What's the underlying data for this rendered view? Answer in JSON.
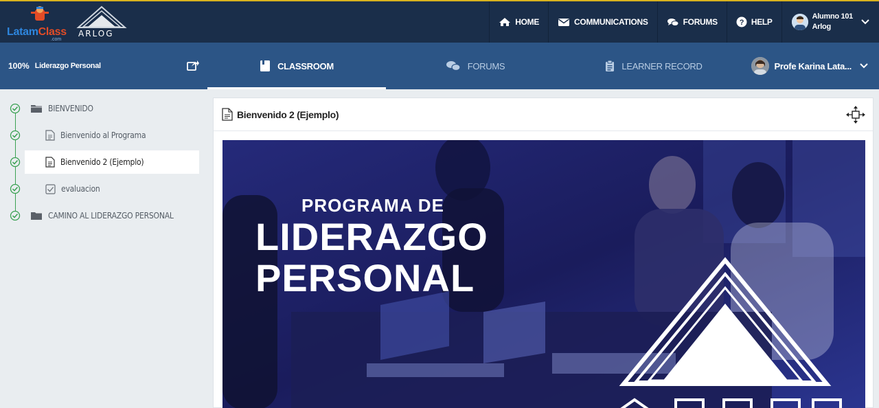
{
  "header": {
    "logo_latam": {
      "brand": "LatamClass",
      "brand_part1": "Latam",
      "brand_part2": "Class",
      "tld": ".com"
    },
    "logo_arlog": {
      "brand": "ARLOG"
    },
    "nav": [
      {
        "label": "HOME",
        "icon": "home-icon"
      },
      {
        "label": "COMMUNICATIONS",
        "icon": "envelope-icon"
      },
      {
        "label": "FORUMS",
        "icon": "chat-bubbles-icon"
      },
      {
        "label": "HELP",
        "icon": "question-circle-icon"
      }
    ],
    "user": {
      "name": "Alumno 101",
      "org": "Arlog"
    }
  },
  "course": {
    "progress": "100%",
    "title": "Liderazgo Personal"
  },
  "tabs": [
    {
      "label": "CLASSROOM",
      "icon": "book-icon",
      "active": true
    },
    {
      "label": "FORUMS",
      "icon": "chat-bubbles-icon",
      "active": false
    },
    {
      "label": "LEARNER RECORD",
      "icon": "clipboard-icon",
      "active": false
    }
  ],
  "instructor": {
    "name": "Profe Karina Lata..."
  },
  "sidebar": {
    "items": [
      {
        "label": "BIENVENIDO",
        "type": "folder",
        "completed": true
      },
      {
        "label": "Bienvenido al Programa",
        "type": "page",
        "completed": true
      },
      {
        "label": "Bienvenido 2 (Ejemplo)",
        "type": "page",
        "completed": true,
        "selected": true
      },
      {
        "label": "evaluacion",
        "type": "checkbox",
        "completed": true
      },
      {
        "label": "CAMINO AL LIDERAZGO PERSONAL",
        "type": "folder",
        "completed": true
      }
    ]
  },
  "main": {
    "title": "Bienvenido 2 (Ejemplo)",
    "banner": {
      "line1": "PROGRAMA DE",
      "line2": "LIDERAZGO",
      "line3": "PERSONAL"
    }
  },
  "colors": {
    "header_bg": "#1a2e4a",
    "subbar_bg": "#2c5586",
    "accent_gold": "#d8b21e",
    "check_green": "#3aa152",
    "banner_bg": "#1c1e66"
  }
}
